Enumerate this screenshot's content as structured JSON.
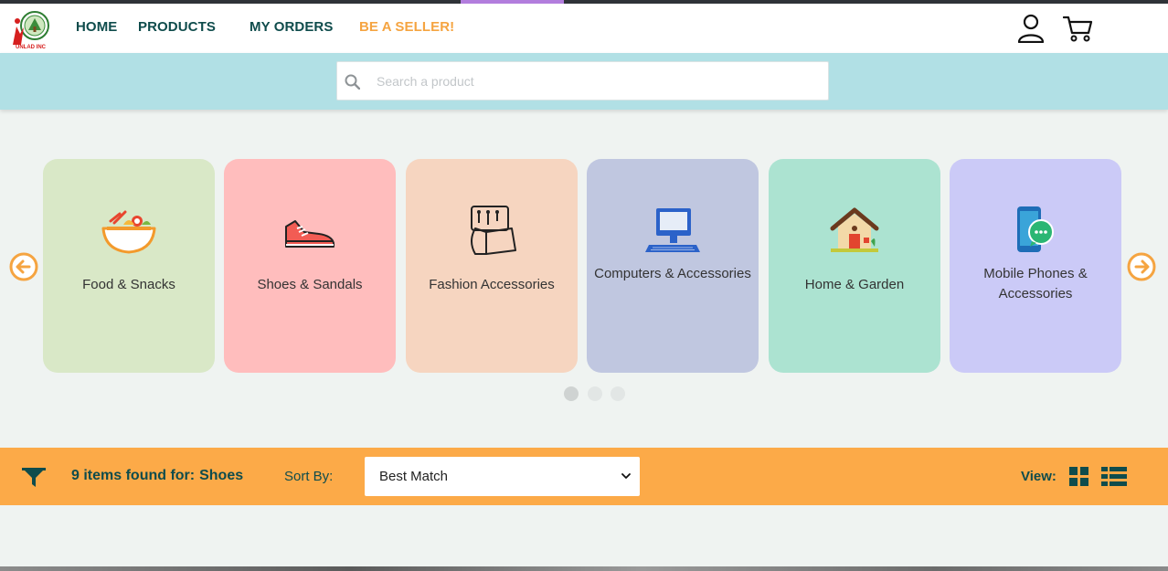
{
  "brand": {
    "logo_text": "UNLAD INC"
  },
  "nav": {
    "home": "HOME",
    "products": "PRODUCTS",
    "my_orders": "MY ORDERS",
    "seller": "BE A SELLER!"
  },
  "search": {
    "placeholder": "Search a product"
  },
  "categories": [
    {
      "label": "Food & Snacks",
      "icon": "salad-bowl-icon",
      "color": "#d9e8c7"
    },
    {
      "label": "Shoes & Sandals",
      "icon": "sneaker-icon",
      "color": "#ffbdbd"
    },
    {
      "label": "Fashion Accessories",
      "icon": "accessories-icon",
      "color": "#f6d5c0"
    },
    {
      "label": "Computers & Accessories",
      "icon": "computer-icon",
      "color": "#c0c7e0"
    },
    {
      "label": "Home & Garden",
      "icon": "house-icon",
      "color": "#ace3d1"
    },
    {
      "label": "Mobile Phones & Accessories",
      "icon": "smartphone-chat-icon",
      "color": "#cbcaf7"
    }
  ],
  "carousel": {
    "pages": 3,
    "active": 1
  },
  "results": {
    "count_text": "9 items found for:",
    "query": "Shoes",
    "sort_label": "Sort By:",
    "sort_value": "Best Match",
    "view_label": "View:"
  },
  "colors": {
    "teal": "#0f4c4c",
    "orange": "#fcaa48",
    "seller": "#f5a441",
    "searchband": "#b1e0e5",
    "arrow": "#f5a441"
  }
}
